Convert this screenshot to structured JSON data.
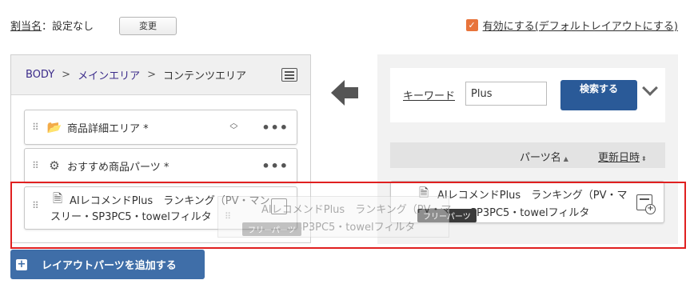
{
  "header": {
    "assign_label": "割当名",
    "assign_value": "：設定なし",
    "change_button": "変更",
    "enable_checked": true,
    "enable_label": "有効にする(デフォルトレイアウトにする)"
  },
  "left_panel": {
    "breadcrumb": [
      "BODY",
      ">",
      "メインエリア",
      ">",
      "コンテンツエリア"
    ],
    "parts": [
      {
        "name": "商品詳細エリア *",
        "icon": "folder-gear-icon"
      },
      {
        "name": "おすすめ商品パーツ *",
        "icon": "gears-icon"
      }
    ],
    "placeholder_text": "AIレコメンドPlus　ランキング（PV・マンスリー・SP3PC5・towelフィルタ"
  },
  "right_panel": {
    "keyword_label": "キーワード",
    "keyword_value": "Plus",
    "search_button": "検索する",
    "sort_name": "パーツ名",
    "sort_date": "更新日時",
    "result": {
      "name": "AIレコメンドPlus　ランキング（PV・マンスリー・SP3PC5・towelフィルタ",
      "badge": "フリーパーツ"
    }
  },
  "drag": {
    "text": "AIレコメンドPlus　ランキング（PV・マンスリー・SP3PC5・towelフィルタ",
    "badge": "フリーパーツ"
  },
  "add_button": "レイアウトパーツを追加する",
  "colors": {
    "accent": "#2a5a98",
    "checkbox": "#e8743b",
    "highlight": "#e02020",
    "link": "#3b2b8a"
  }
}
